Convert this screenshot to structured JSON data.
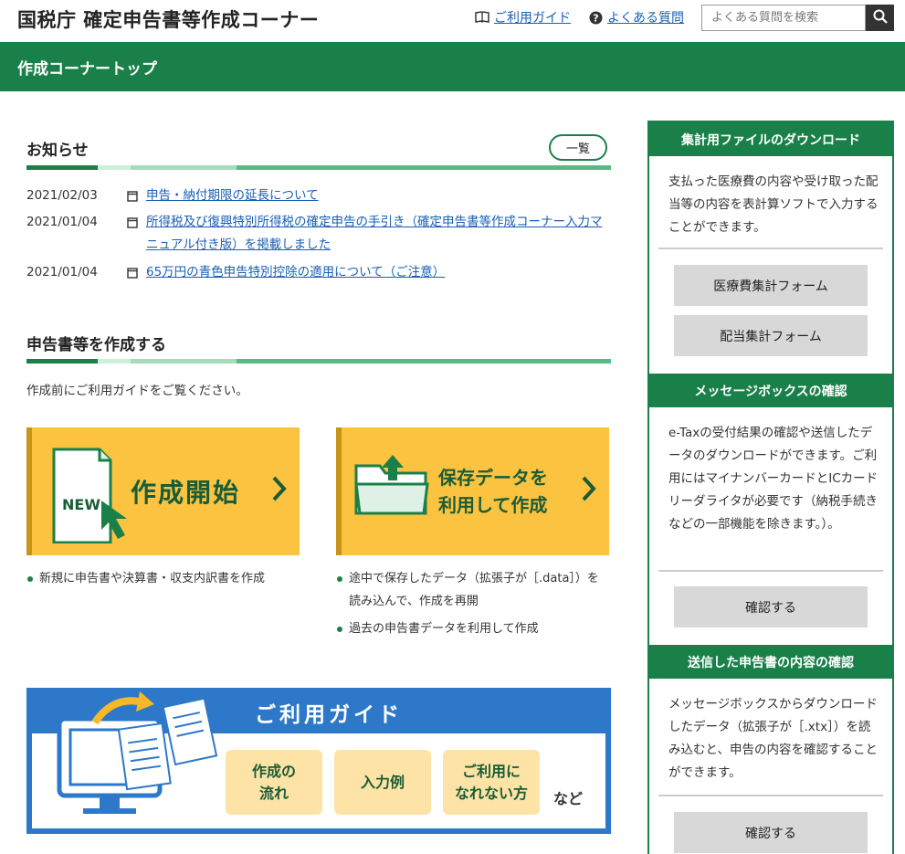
{
  "header": {
    "site_title": "国税庁 確定申告書等作成コーナー",
    "guide_link": "ご利用ガイド",
    "faq_link": "よくある質問",
    "search_placeholder": "よくある質問を検索"
  },
  "topbar": {
    "label": "作成コーナートップ"
  },
  "news": {
    "title": "お知らせ",
    "more_label": "一覧",
    "items": [
      {
        "date": "2021/02/03",
        "text": "申告・納付期限の延長について"
      },
      {
        "date": "2021/01/04",
        "text": "所得税及び復興特別所得税の確定申告の手引き（確定申告書等作成コーナー入力マニュアル付き版）を掲載しました"
      },
      {
        "date": "2021/01/04",
        "text": "65万円の青色申告特別控除の適用について（ご注意）"
      }
    ]
  },
  "create": {
    "title": "申告書等を作成する",
    "lead": "作成前にご利用ガイドをご覧ください。",
    "new_badge": "NEW",
    "start_label": "作成開始",
    "saved_label_1": "保存データを",
    "saved_label_2": "利用して作成",
    "start_bullets": [
      "新規に申告書や決算書・収支内訳書を作成"
    ],
    "saved_bullets": [
      "途中で保存したデータ（拡張子が［.data］）を読み込んで、作成を再開",
      "過去の申告書データを利用して作成"
    ]
  },
  "guide": {
    "title": "ご利用ガイド",
    "flow_1": "作成の",
    "flow_2": "流れ",
    "example": "入力例",
    "unable_1": "ご利用に",
    "unable_2": "なれない方",
    "etc": "など"
  },
  "sidebar": {
    "download": {
      "title": "集計用ファイルのダウンロード",
      "text": "支払った医療費の内容や受け取った配当等の内容を表計算ソフトで入力することができます。",
      "btn_medical": "医療費集計フォーム",
      "btn_dividend": "配当集計フォーム"
    },
    "messagebox": {
      "title": "メッセージボックスの確認",
      "text": "e-Taxの受付結果の確認や送信したデータのダウンロードができます。ご利用にはマイナンバーカードとICカードリーダライタが必要です（納税手続きなどの一部機能を除きます。）。",
      "btn": "確認する"
    },
    "sent": {
      "title": "送信した申告書の内容の確認",
      "text": "メッセージボックスからダウンロードしたデータ（拡張子が［.xtx］）を読み込むと、申告の内容を確認することができます。",
      "btn": "確認する"
    }
  },
  "colors": {
    "green": "#1a8049",
    "light_green": "#58bb86",
    "yellow": "#fbc33f",
    "blue": "#2e78c9",
    "link": "#1a5fb4"
  }
}
